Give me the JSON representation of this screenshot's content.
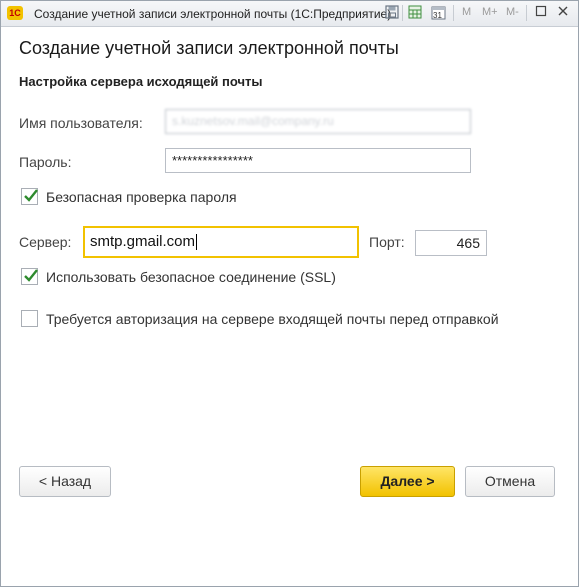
{
  "window": {
    "title": "Создание учетной записи электронной почты  (1С:Предприятие)",
    "app_icon_text": "1С"
  },
  "titlebar": {
    "m_label": "M",
    "m_plus_label": "M+",
    "m_minus_label": "M-",
    "calendar_day": "31"
  },
  "main": {
    "heading": "Создание учетной записи электронной почты",
    "subheading": "Настройка сервера исходящей почты",
    "username_label": "Имя пользователя:",
    "username_value": "s.kuznetsov.mail@company.ru",
    "password_label": "Пароль:",
    "password_value": "****************",
    "secure_password_label": "Безопасная проверка пароля",
    "secure_password_checked": true,
    "server_label": "Сервер:",
    "server_value": "smtp.gmail.com",
    "port_label": "Порт:",
    "port_value": "465",
    "ssl_label": "Использовать безопасное соединение (SSL)",
    "ssl_checked": true,
    "auth_label": "Требуется авторизация на сервере входящей почты перед отправкой",
    "auth_checked": false
  },
  "footer": {
    "back_label": "< Назад",
    "next_label": "Далее >",
    "cancel_label": "Отмена"
  },
  "colors": {
    "accent": "#f2c200",
    "check": "#2e8b2e"
  }
}
